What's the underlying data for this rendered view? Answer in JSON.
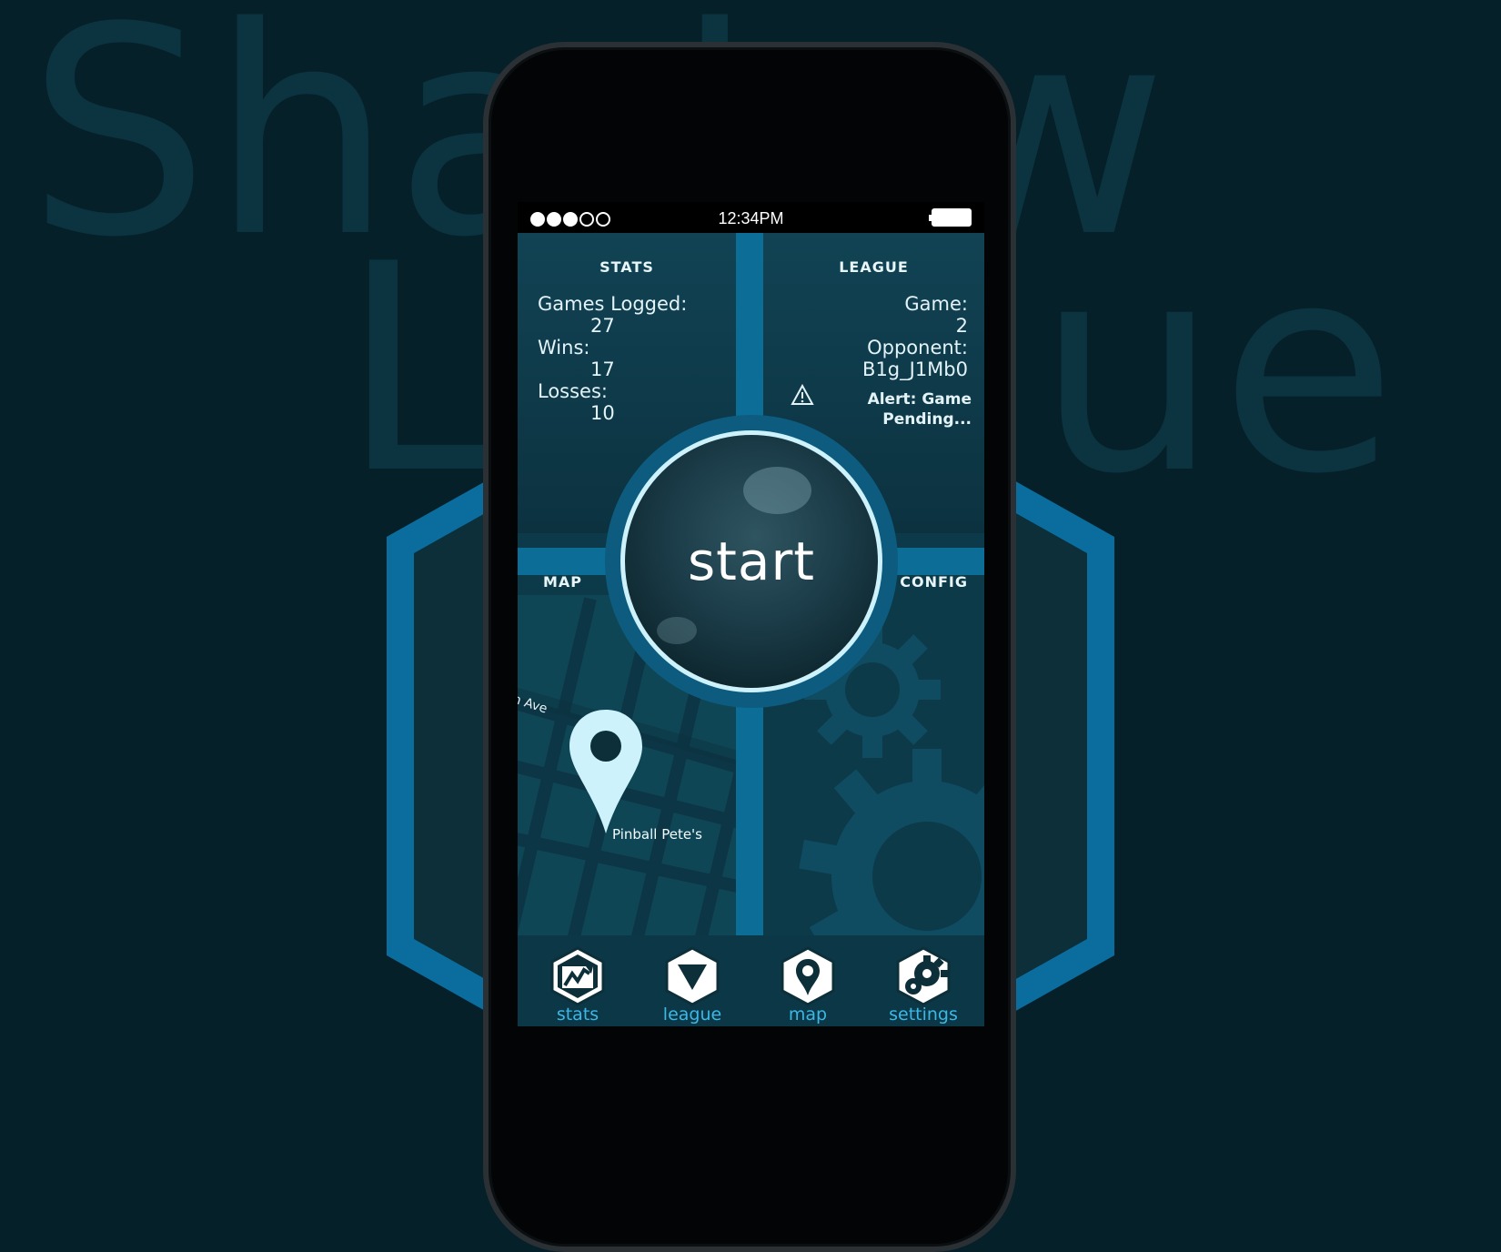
{
  "background": {
    "title_line1": "Shadow",
    "title_line2": "League",
    "colors": {
      "background": "#06202a",
      "title": "#0b3440",
      "shield": "#0a6d9e"
    }
  },
  "statusbar": {
    "signal_bars": 3,
    "signal_total": 5,
    "time": "12:34PM"
  },
  "stats": {
    "title": "STATS",
    "games_logged_label": "Games Logged:",
    "games_logged": "27",
    "wins_label": "Wins:",
    "wins": "17",
    "losses_label": "Losses:",
    "losses": "10"
  },
  "league": {
    "title": "LEAGUE",
    "game_label": "Game:",
    "game": "2",
    "opponent_label": "Opponent:",
    "opponent": "B1g_J1Mb0",
    "alert_line1": "Alert: Game",
    "alert_line2": "Pending..."
  },
  "start": {
    "label": "start"
  },
  "map": {
    "title": "MAP",
    "street": "h Ave",
    "place": "Pinball Pete's"
  },
  "config": {
    "title": "CONFIG"
  },
  "tabs": [
    {
      "label": "stats",
      "icon": "stats-icon"
    },
    {
      "label": "league",
      "icon": "league-icon"
    },
    {
      "label": "map",
      "icon": "map-pin-icon"
    },
    {
      "label": "settings",
      "icon": "settings-icon"
    }
  ],
  "colors": {
    "accent": "#0c6d97",
    "tab_label": "#3db7e6",
    "pin": "#cdf2fb"
  }
}
